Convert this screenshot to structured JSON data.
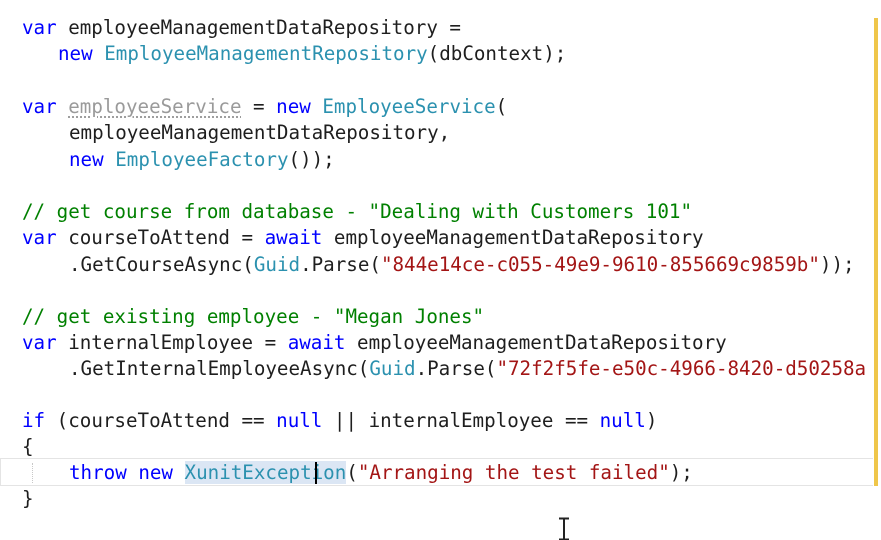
{
  "code": {
    "l1": {
      "kw": "var",
      "name": " employeeManagementDataRepository =",
      "tail": ""
    },
    "l2": {
      "kw": "new",
      "type": "EmployeeManagementRepository",
      "args": "(dbContext);"
    },
    "l3": {
      "kw": "var",
      "unused": "employeeService",
      "eq": " = ",
      "kw2": "new",
      "type": "EmployeeService",
      "tail": "("
    },
    "l4": {
      "text": "employeeManagementDataRepository,"
    },
    "l5": {
      "kw": "new",
      "type": "EmployeeFactory",
      "tail": "());"
    },
    "l6": {
      "comment": "// get course from database - \"Dealing with Customers 101\""
    },
    "l7": {
      "kw": "var",
      "name": " courseToAttend = ",
      "kw2": "await",
      "tail": " employeeManagementDataRepository"
    },
    "l8": {
      "method": ".GetCourseAsync(",
      "type": "Guid",
      "parse": ".Parse(",
      "str": "\"844e14ce-c055-49e9-9610-855669c9859b\"",
      "tail": "));"
    },
    "l9": {
      "comment": "// get existing employee - \"Megan Jones\""
    },
    "l10": {
      "kw": "var",
      "name": " internalEmployee = ",
      "kw2": "await",
      "tail": " employeeManagementDataRepository"
    },
    "l11": {
      "method": ".GetInternalEmployeeAsync(",
      "type": "Guid",
      "parse": ".Parse(",
      "str": "\"72f2f5fe-e50c-4966-8420-d50258a"
    },
    "l12": {
      "kw": "if",
      "tail": " (courseToAttend == ",
      "kw2": "null",
      "mid": " || internalEmployee == ",
      "kw3": "null",
      "end": ")"
    },
    "l13": {
      "text": "{"
    },
    "l14": {
      "kw": "throw",
      "kw2": "new",
      "type": "XunitException",
      "open": "(",
      "str": "\"Arranging the test failed\"",
      "tail": ");"
    },
    "l15": {
      "text": "}"
    }
  },
  "icons": {
    "cursor": "text-cursor-ibeam-icon"
  },
  "colors": {
    "keyword": "#0000ff",
    "type": "#2b91af",
    "string": "#a31515",
    "comment": "#008000",
    "identifier": "#1e1e1e",
    "change_marker": "#efc64a"
  }
}
